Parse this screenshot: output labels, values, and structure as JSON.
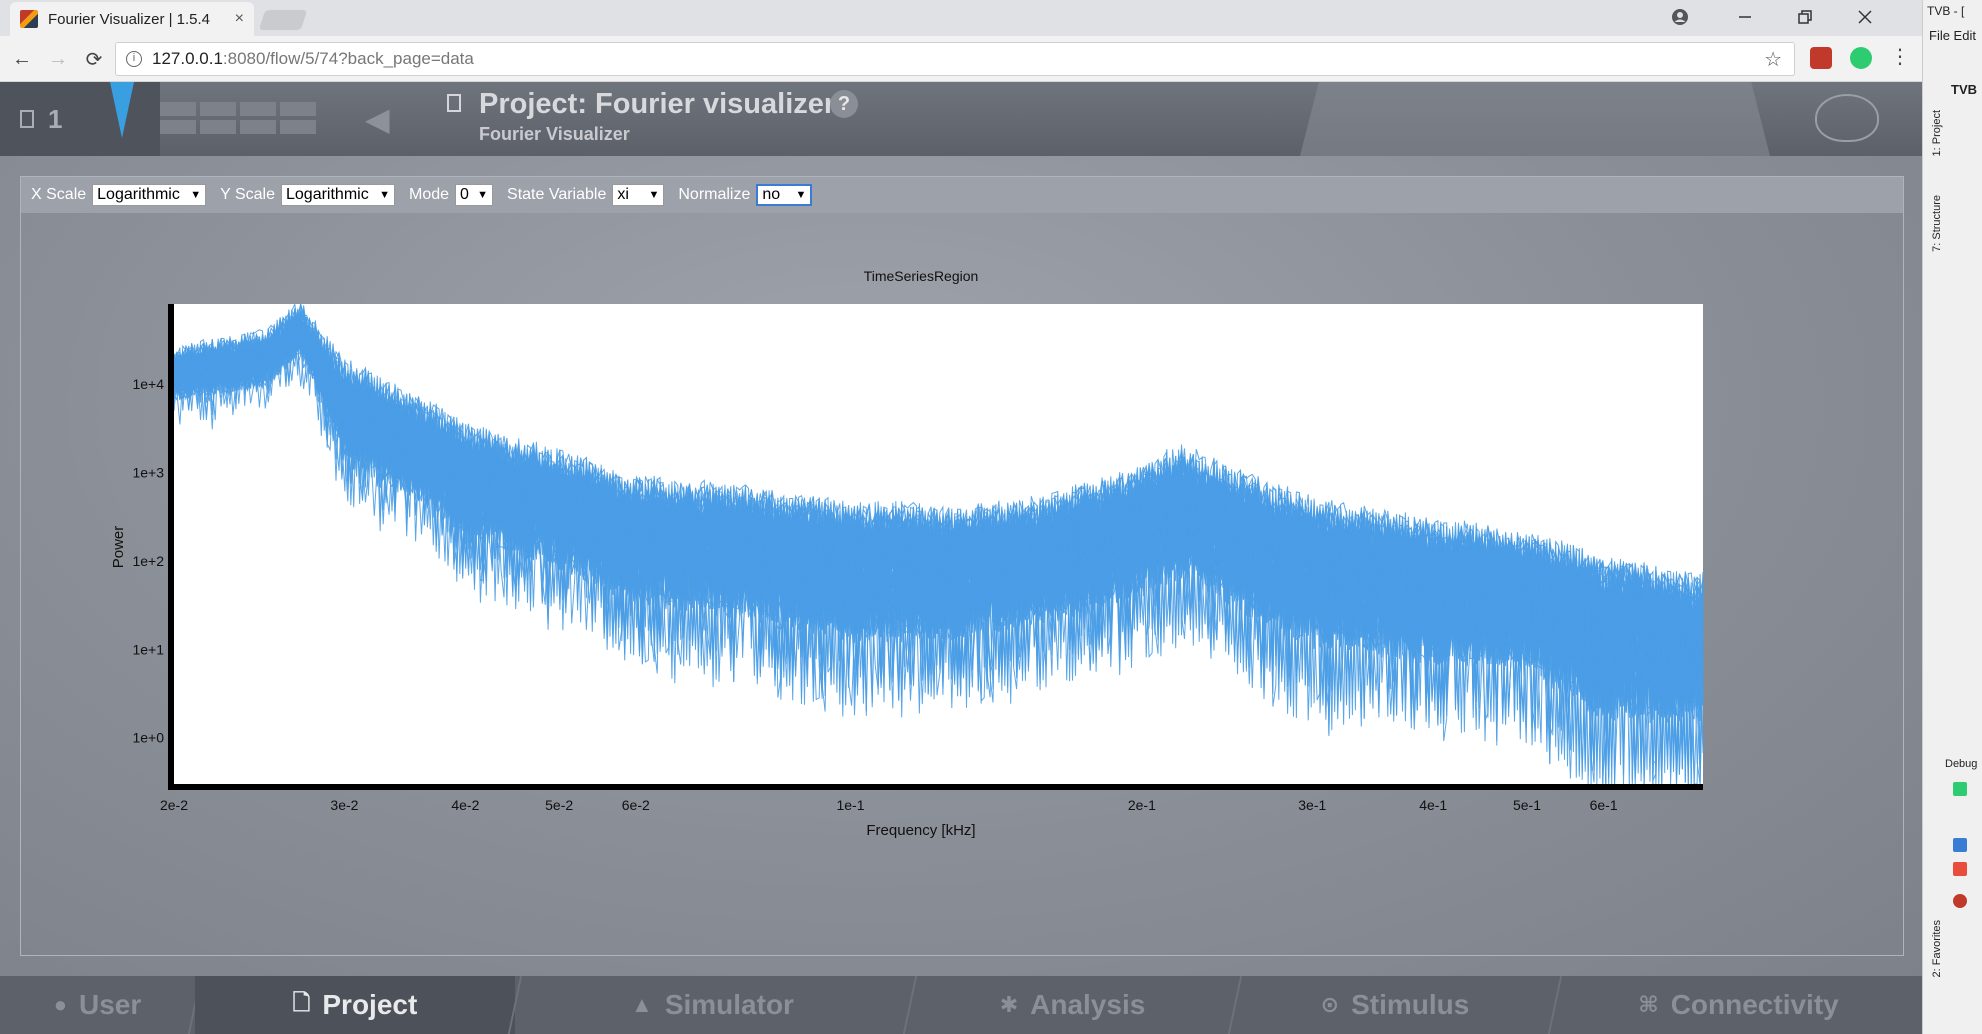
{
  "browser": {
    "tab_title": "Fourier Visualizer | 1.5.4",
    "tab_close": "×",
    "url_host": "127.0.0.1",
    "url_rest": ":8080/flow/5/74?back_page=data",
    "info_glyph": "i",
    "star_glyph": "☆"
  },
  "header": {
    "count": "1",
    "project_title": "Project: Fourier visualizer",
    "subtitle": "Fourier Visualizer",
    "help_glyph": "?"
  },
  "controls": {
    "x_scale_label": "X Scale",
    "x_scale_value": "Logarithmic",
    "y_scale_label": "Y Scale",
    "y_scale_value": "Logarithmic",
    "mode_label": "Mode",
    "mode_value": "0",
    "state_variable_label": "State Variable",
    "state_variable_value": "xi",
    "normalize_label": "Normalize",
    "normalize_value": "no"
  },
  "chart_data": {
    "type": "line",
    "title": "TimeSeriesRegion",
    "xlabel": "Frequency [kHz]",
    "ylabel": "Power",
    "x_scale": "log",
    "y_scale": "log",
    "xlim": [
      0.02,
      0.76
    ],
    "ylim": [
      0.3,
      80000
    ],
    "x_ticks": [
      {
        "value": 0.02,
        "label": "2e-2"
      },
      {
        "value": 0.03,
        "label": "3e-2"
      },
      {
        "value": 0.04,
        "label": "4e-2"
      },
      {
        "value": 0.05,
        "label": "5e-2"
      },
      {
        "value": 0.06,
        "label": "6e-2"
      },
      {
        "value": 0.1,
        "label": "1e-1"
      },
      {
        "value": 0.2,
        "label": "2e-1"
      },
      {
        "value": 0.3,
        "label": "3e-1"
      },
      {
        "value": 0.4,
        "label": "4e-1"
      },
      {
        "value": 0.5,
        "label": "5e-1"
      },
      {
        "value": 0.6,
        "label": "6e-1"
      }
    ],
    "y_ticks": [
      {
        "value": 1,
        "label": "1e+0"
      },
      {
        "value": 10,
        "label": "1e+1"
      },
      {
        "value": 100,
        "label": "1e+2"
      },
      {
        "value": 1000,
        "label": "1e+3"
      },
      {
        "value": 10000,
        "label": "1e+4"
      }
    ],
    "series_count": 76,
    "series_color": "#4a9de6",
    "envelope": {
      "x": [
        0.02,
        0.025,
        0.027,
        0.03,
        0.035,
        0.04,
        0.05,
        0.06,
        0.08,
        0.1,
        0.13,
        0.16,
        0.2,
        0.22,
        0.25,
        0.3,
        0.35,
        0.4,
        0.5,
        0.6,
        0.76
      ],
      "median": [
        13000,
        18000,
        40000,
        5000,
        2200,
        1000,
        450,
        250,
        180,
        120,
        110,
        150,
        300,
        500,
        250,
        130,
        90,
        70,
        60,
        30,
        20
      ],
      "spread_low": [
        0.5,
        0.5,
        0.6,
        0.2,
        0.15,
        0.1,
        0.08,
        0.05,
        0.04,
        0.03,
        0.04,
        0.05,
        0.05,
        0.05,
        0.04,
        0.02,
        0.03,
        0.03,
        0.03,
        0.01,
        0.02
      ],
      "spread_high": [
        1.6,
        1.8,
        1.8,
        3.0,
        3.2,
        3.0,
        3.2,
        3.0,
        3.0,
        3.2,
        3.0,
        3.0,
        3.2,
        3.5,
        3.5,
        3.2,
        3.5,
        3.5,
        3.0,
        3.0,
        3.0
      ]
    },
    "grid": false,
    "legend": "none"
  },
  "bottom_nav": [
    {
      "label": "User",
      "icon": "user-icon",
      "glyph": "●",
      "active": false
    },
    {
      "label": "Project",
      "icon": "document-icon",
      "glyph": "🗋",
      "active": true
    },
    {
      "label": "Simulator",
      "icon": "rocket-icon",
      "glyph": "▲",
      "active": false
    },
    {
      "label": "Analysis",
      "icon": "gear-icon",
      "glyph": "✱",
      "active": false
    },
    {
      "label": "Stimulus",
      "icon": "location-pin-icon",
      "glyph": "⊙",
      "active": false
    },
    {
      "label": "Connectivity",
      "icon": "connectivity-icon",
      "glyph": "⌘",
      "active": false
    }
  ],
  "ide": {
    "title": "TVB - [",
    "menu": "File  Edit",
    "project_root": "TVB",
    "tab_project": "1: Project",
    "tab_structure": "7: Structure",
    "tab_favorites": "2: Favorites",
    "debug": "Debug"
  },
  "colors": {
    "accent": "#3a9fe0",
    "header": "#5b6069",
    "background": "#8a8e96",
    "series": "#4a9de6"
  }
}
